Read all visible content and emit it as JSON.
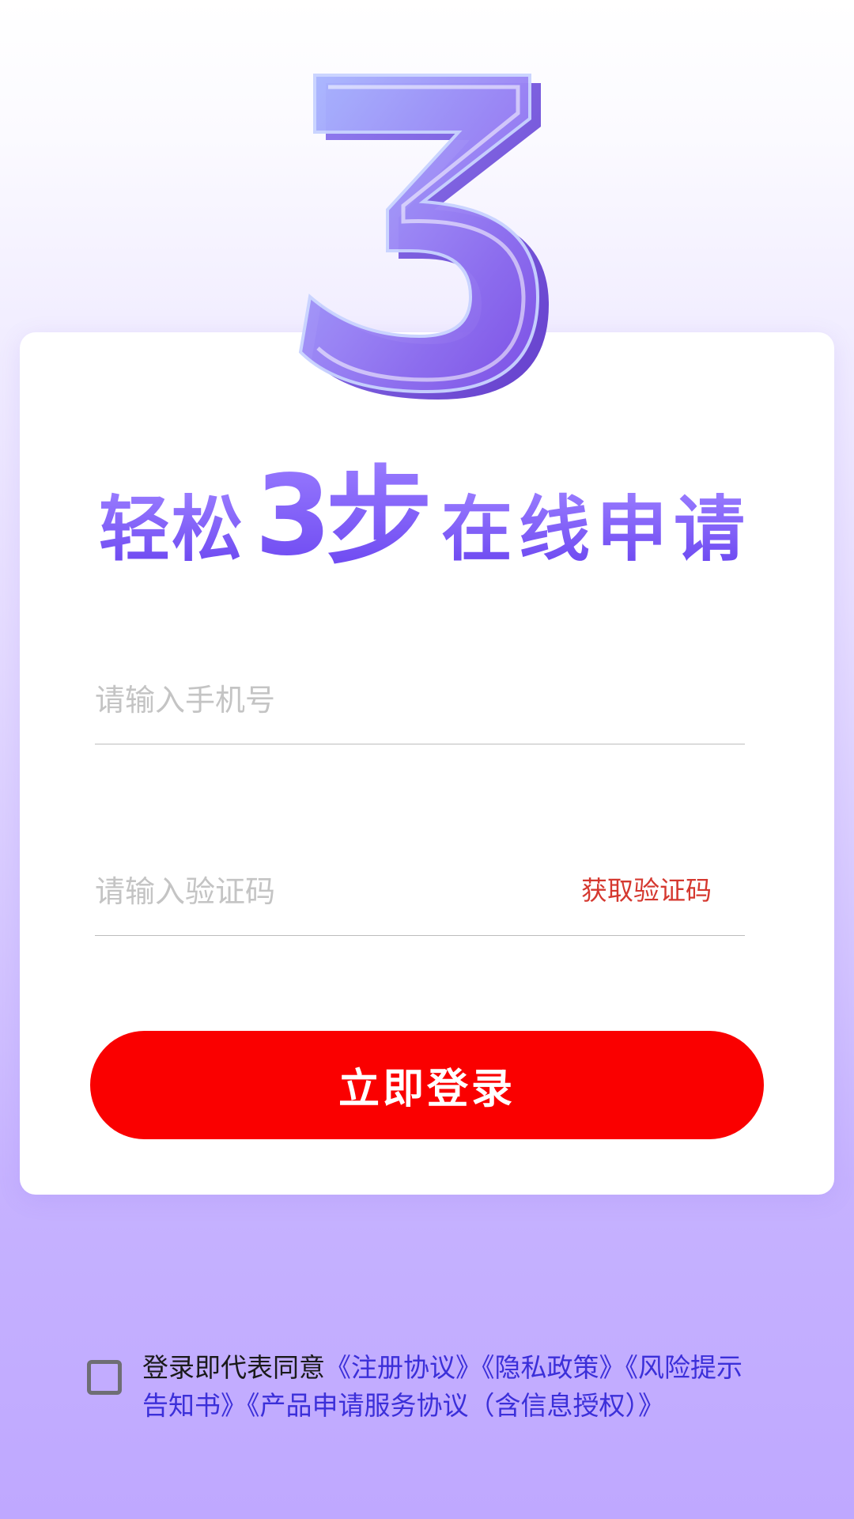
{
  "hero": {
    "icon": "number-three-3d-icon",
    "slogan": {
      "part1": "轻松",
      "number": "3",
      "part2": "步",
      "part3": "在线申请"
    }
  },
  "form": {
    "phone_placeholder": "请输入手机号",
    "code_placeholder": "请输入验证码",
    "get_code_label": "获取验证码",
    "login_label": "立即登录"
  },
  "agreement": {
    "checked": false,
    "prefix": "登录即代表同意",
    "links": [
      "《注册协议》",
      "《隐私政策》",
      "《风险提示告知书》",
      "《产品申请服务协议（含信息授权）》"
    ]
  },
  "colors": {
    "accent_purple": "#7b5cf0",
    "button_red": "#fa0000",
    "link_blue": "#3b2fd9",
    "get_code_red": "#d5382f"
  }
}
